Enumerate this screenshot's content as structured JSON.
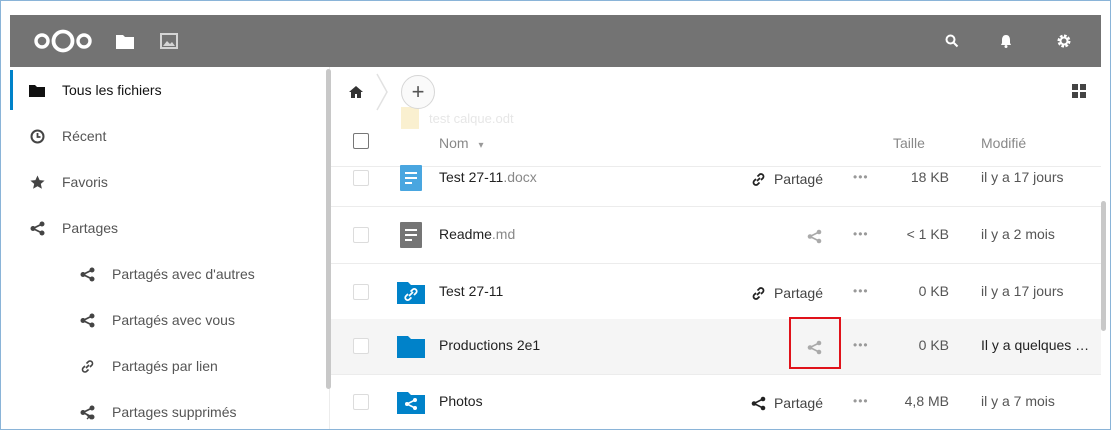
{
  "header": {
    "logo_icon": "nextcloud-logo-icon",
    "apps": [
      {
        "name": "files-app-icon",
        "active": true
      },
      {
        "name": "gallery-app-icon",
        "active": false
      }
    ],
    "right_icons": [
      "search-icon",
      "notifications-icon",
      "settings-icon"
    ],
    "bg_color": "#737373"
  },
  "sidebar": {
    "items": [
      {
        "label": "Tous les fichiers",
        "icon": "folder-icon",
        "active": true
      },
      {
        "label": "Récent",
        "icon": "clock-icon"
      },
      {
        "label": "Favoris",
        "icon": "star-icon"
      },
      {
        "label": "Partages",
        "icon": "share-icon"
      },
      {
        "label": "Partagés avec d'autres",
        "icon": "share-icon",
        "sub": true
      },
      {
        "label": "Partagés avec vous",
        "icon": "share-icon",
        "sub": true
      },
      {
        "label": "Partagés par lien",
        "icon": "link-icon",
        "sub": true
      },
      {
        "label": "Partages supprimés",
        "icon": "share-deleted-icon",
        "sub": true
      }
    ]
  },
  "controls": {
    "add_label": "+",
    "ghost_text": "test calque.odt"
  },
  "table": {
    "headers": {
      "name": "Nom",
      "size": "Taille",
      "modified": "Modifié"
    },
    "rows": [
      {
        "name": "Test 27-11",
        "ext": ".docx",
        "icon": "document-icon",
        "share": "Partagé",
        "share_icon": "link-icon",
        "more": "•••",
        "size": "18 KB",
        "modified": "il y a 17 jours"
      },
      {
        "name": "Readme",
        "ext": ".md",
        "icon": "text-file-icon",
        "share": "",
        "share_icon": "share-icon",
        "more": "•••",
        "size": "< 1 KB",
        "modified": "il y a 2 mois"
      },
      {
        "name": "Test 27-11",
        "ext": "",
        "icon": "link-folder-icon",
        "share": "Partagé",
        "share_icon": "link-icon",
        "more": "•••",
        "size": "0 KB",
        "modified": "il y a 17 jours"
      },
      {
        "name": "Productions 2e1",
        "ext": "",
        "icon": "folder-icon",
        "share": "",
        "share_icon": "share-icon",
        "more": "•••",
        "size": "0 KB",
        "modified": "Il y a quelques secondes"
      },
      {
        "name": "Photos",
        "ext": "",
        "icon": "shared-folder-icon",
        "share": "Partagé",
        "share_icon": "share-icon",
        "more": "•••",
        "size": "4,8 MB",
        "modified": "il y a 7 mois"
      }
    ]
  },
  "colors": {
    "accent": "#0082c9",
    "highlight": "#e0121a"
  }
}
